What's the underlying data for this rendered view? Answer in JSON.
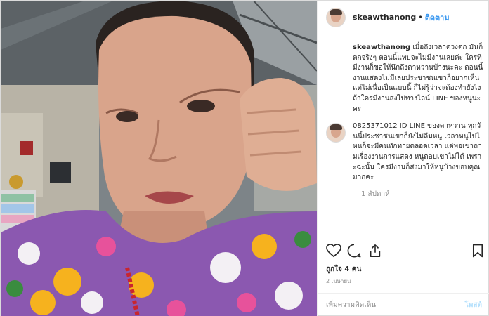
{
  "post": {
    "username": "skeawthanong",
    "separator": "•",
    "follow_label": "ติดตาม",
    "caption_user": "skeawthanong",
    "caption_text": "เมื่อถึงเวลาดวงตก มันก็ตกจริงๆ ตอนนี้แทบจะไม่มีงานเลยค่ะ ใครที่มีงานก็ขอให้นึกถึงดาหวานบ้างนะคะ ตอนนี้งานแสดงไม่มีเลยประชาชนเขาก็อยากเห็นแต่ไม่เนื่อเป็นแบบนี้ ก็ไม่รู้ว่าจะต้องทำยังไง ถ้าใครมีงานส่งไปทางไลน์ LINE ของหนูนะคะ",
    "comment_text": "0825371012 ID LINE ของดาหวาน ทุกวันนี้ประชาชนเขาก็ยังไม่ลืมหนู เวลาหนูไปไหนก็จะมีคนทักทายตลอดเวลา แต่พอเขาถามเรื่องงานการแสดง หนูตอบเขาไม่ได้ เพราะฉะนั้น ใครมีงานก็ส่งมาให้หนูบ้างขอบคุณมากคะ",
    "comment_time": "1 สัปดาห์",
    "likes": "ถูกใจ 4 คน",
    "date": "2 เมษายน",
    "add_comment_placeholder": "เพิ่มความคิดเห็น",
    "post_label": "โพสต์"
  },
  "icons": {
    "like": "heart-icon",
    "comment": "comment-icon",
    "share": "share-icon",
    "save": "bookmark-icon"
  },
  "colors": {
    "accent": "#3897f0",
    "muted": "#8e8e8e",
    "post_disabled": "#b2dffc"
  }
}
